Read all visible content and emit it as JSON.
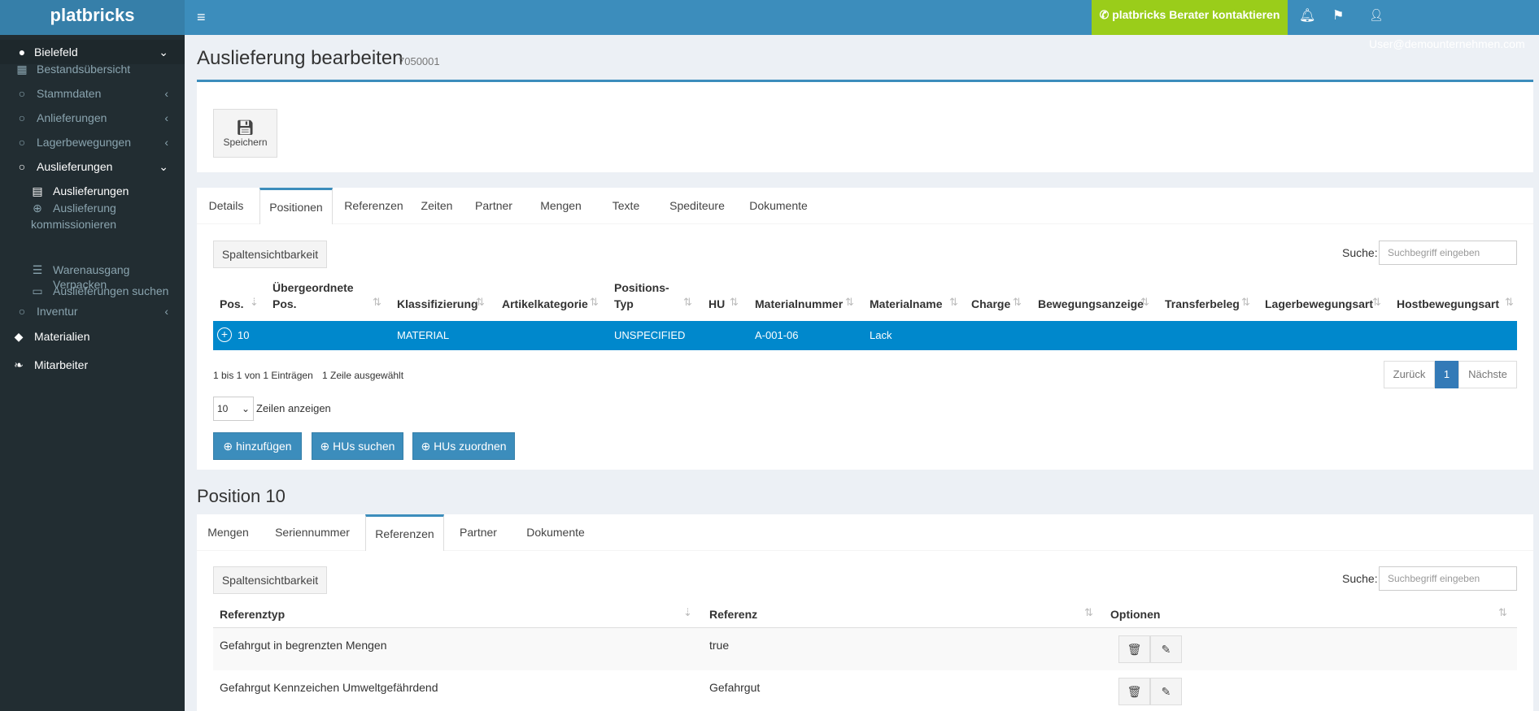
{
  "header": {
    "brand": "platbricks",
    "menu_icon": "hamburger-icon",
    "consult_label": "platbricks Berater kontaktieren",
    "consult_icon": "phone-icon",
    "bell_icon": "bell-icon",
    "flag_icon": "flag-icon",
    "user_icon": "user-icon",
    "user_label": "User@demounternehmen.com",
    "colors": {
      "header": "#3c8dbc",
      "logo": "#367fa9",
      "consult": "#9acd1a",
      "sidebar": "#222d32"
    }
  },
  "sidebar": {
    "location": "Bielefeld",
    "items": [
      {
        "label": "Bestandsübersicht",
        "icon": "grid-icon"
      },
      {
        "label": "Stammdaten",
        "icon": "circle-icon"
      },
      {
        "label": "Anlieferungen",
        "icon": "circle-icon"
      },
      {
        "label": "Lagerbewegungen",
        "icon": "circle-icon"
      },
      {
        "label": "Auslieferungen",
        "icon": "circle-icon"
      },
      {
        "label": "Inventur",
        "icon": "circle-icon"
      },
      {
        "label": "Materialien",
        "icon": "tag-icon"
      },
      {
        "label": "Mitarbeiter",
        "icon": "leaf-icon"
      }
    ],
    "subitems": [
      {
        "label": "Auslieferungen",
        "icon": "file-icon"
      },
      {
        "label": "Auslieferung",
        "label2": "kommissionieren",
        "icon": "plus-circle-icon"
      },
      {
        "label": "Warenausgang Verpacken",
        "icon": "list-icon"
      },
      {
        "label": "Auslieferungen suchen",
        "icon": "archive-icon"
      }
    ]
  },
  "page": {
    "title": "Auslieferung bearbeiten",
    "subtitle": "7050001",
    "save_label": "Speichern"
  },
  "tabs1": [
    "Details",
    "Positionen",
    "Referenzen",
    "Zeiten",
    "Partner",
    "Mengen",
    "Texte",
    "Spediteure",
    "Dokumente"
  ],
  "positions": {
    "column_vis": "Spaltensichtbarkeit",
    "search_label": "Suche:",
    "search_placeholder": "Suchbegriff eingeben",
    "headers": [
      "Pos.",
      "Übergeordnete",
      "Pos.",
      "Klassifizierung",
      "Artikelkategorie",
      "Positions-",
      "Typ",
      "HU",
      "Materialnummer",
      "Materialname",
      "Charge",
      "Bewegungsanzeige",
      "Transferbeleg",
      "Lagerbewegungsart",
      "Hostbewegungsart"
    ],
    "row": {
      "pos": "10",
      "klass": "MATERIAL",
      "typ": "UNSPECIFIED",
      "matnr": "A-001-06",
      "matname": "Lack"
    },
    "info": "1 bis 1 von 1 Einträgen",
    "selected": "1 Zeile ausgewählt",
    "pager": {
      "prev": "Zurück",
      "page": "1",
      "next": "Nächste"
    },
    "length_value": "10",
    "length_label": "Zeilen anzeigen",
    "buttons": [
      "hinzufügen",
      "HUs suchen",
      "HUs zuordnen"
    ]
  },
  "position_title": "Position 10",
  "tabs2": [
    "Mengen",
    "Seriennummer",
    "Referenzen",
    "Partner",
    "Dokumente"
  ],
  "references": {
    "column_vis": "Spaltensichtbarkeit",
    "search_label": "Suche:",
    "search_placeholder": "Suchbegriff eingeben",
    "headers": [
      "Referenztyp",
      "Referenz",
      "Optionen"
    ],
    "rows": [
      {
        "typ": "Gefahrgut in begrenzten Mengen",
        "ref": "true"
      },
      {
        "typ": "Gefahrgut Kennzeichen Umweltgefährdend",
        "ref": "Gefahrgut"
      }
    ]
  }
}
